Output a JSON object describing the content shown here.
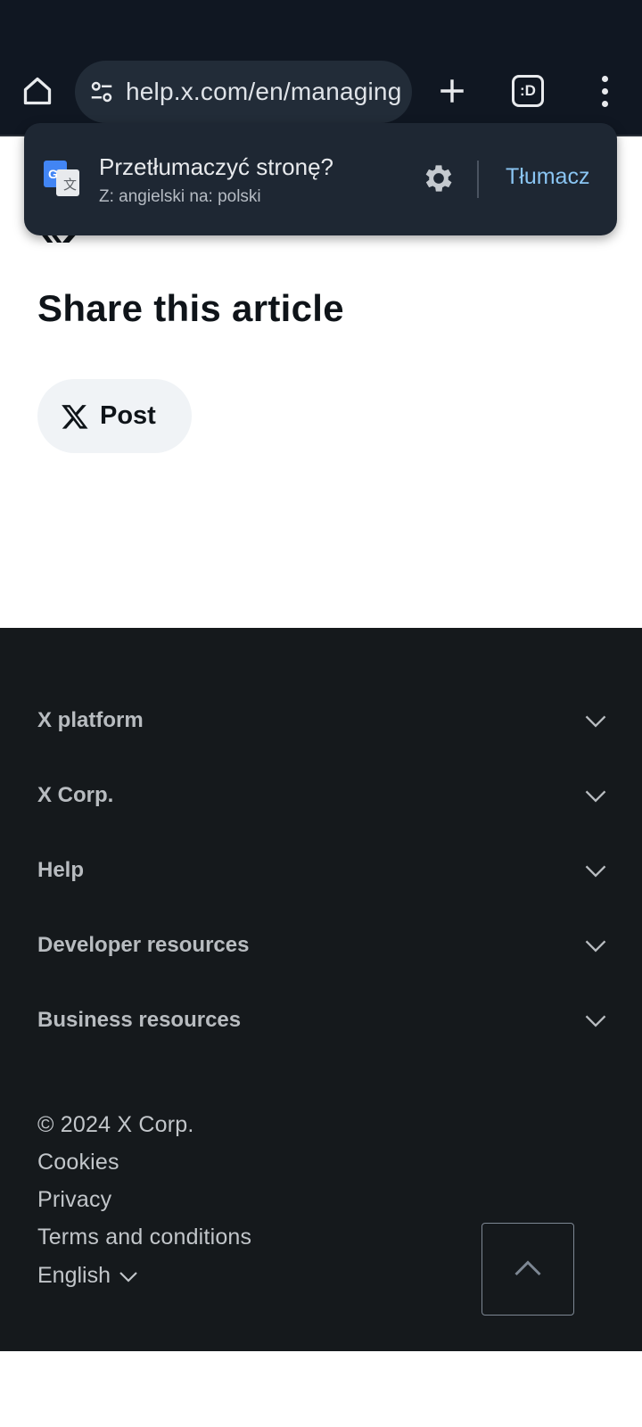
{
  "browser": {
    "url": "help.x.com/en/managing",
    "tab_switcher_label": ":D"
  },
  "translate_popup": {
    "title": "Przetłumaczyć stronę?",
    "subtitle": "Z: angielski na: polski",
    "action": "Tłumacz"
  },
  "article": {
    "share_title": "Share this article",
    "post_button": "Post"
  },
  "footer": {
    "sections": [
      {
        "label": "X platform"
      },
      {
        "label": "X Corp."
      },
      {
        "label": "Help"
      },
      {
        "label": "Developer resources"
      },
      {
        "label": "Business resources"
      }
    ],
    "copyright": "© 2024 X Corp.",
    "links": [
      {
        "label": "Cookies"
      },
      {
        "label": "Privacy"
      },
      {
        "label": "Terms and conditions"
      }
    ],
    "language": "English"
  },
  "colors": {
    "chrome_bg": "#101722",
    "popup_bg": "#1e2733",
    "footer_bg": "#15191c",
    "accent_link": "#8ac5f3"
  }
}
